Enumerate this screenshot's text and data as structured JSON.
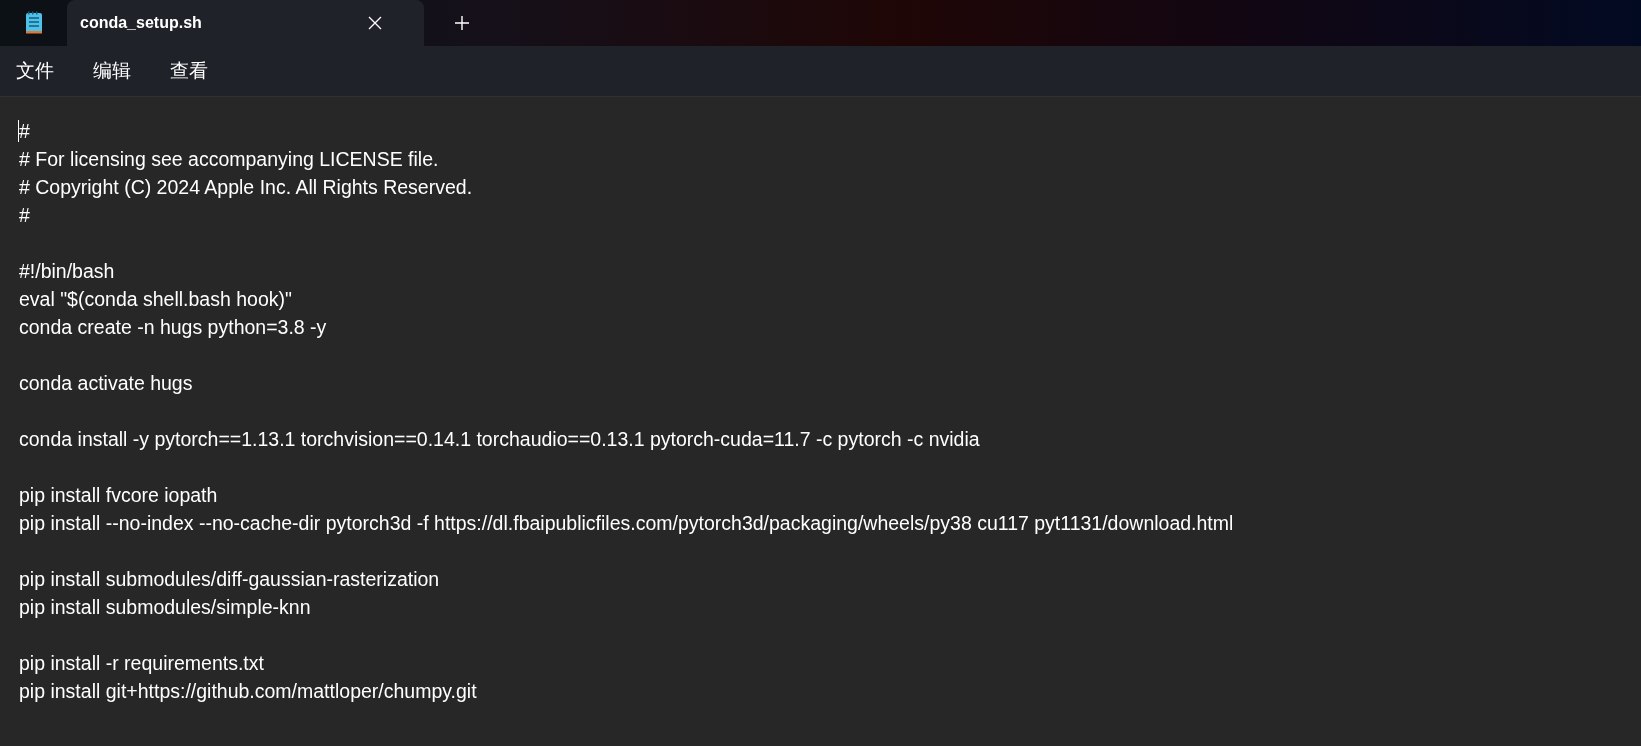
{
  "tabs": [
    {
      "label": "conda_setup.sh",
      "selected": true
    }
  ],
  "menu": [
    "文件",
    "编辑",
    "查看"
  ],
  "editor": {
    "blocks": [
      [
        "#",
        "# For licensing see accompanying LICENSE file.",
        "# Copyright (C) 2024 Apple Inc. All Rights Reserved.",
        "#"
      ],
      [
        "#!/bin/bash",
        "eval \"$(conda shell.bash hook)\"",
        "conda create -n hugs python=3.8 -y"
      ],
      [
        "conda activate hugs"
      ],
      [
        "conda install -y pytorch==1.13.1 torchvision==0.14.1 torchaudio==0.13.1 pytorch-cuda=11.7 -c pytorch -c nvidia"
      ],
      [
        "pip install fvcore iopath",
        "pip install --no-index --no-cache-dir pytorch3d -f https://dl.fbaipublicfiles.com/pytorch3d/packaging/wheels/py38 cu117 pyt1131/download.html"
      ],
      [
        "pip install submodules/diff-gaussian-rasterization",
        "pip install submodules/simple-knn"
      ],
      [
        "pip install -r requirements.txt",
        "pip install git+https://github.com/mattloper/chumpy.git"
      ]
    ]
  }
}
